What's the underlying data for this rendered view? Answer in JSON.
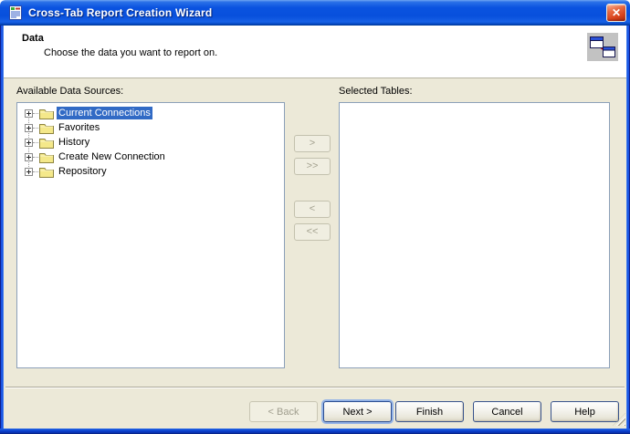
{
  "window": {
    "title": "Cross-Tab Report Creation Wizard",
    "close_icon": "✕"
  },
  "header": {
    "title": "Data",
    "subtitle": "Choose the data you want to report on."
  },
  "available": {
    "label": "Available Data Sources:"
  },
  "selected": {
    "label": "Selected Tables:"
  },
  "tree": {
    "items": [
      {
        "label": "Current Connections",
        "selected": true
      },
      {
        "label": "Favorites",
        "selected": false
      },
      {
        "label": "History",
        "selected": false
      },
      {
        "label": "Create New Connection",
        "selected": false
      },
      {
        "label": "Repository",
        "selected": false
      }
    ]
  },
  "transfer": {
    "add": ">",
    "add_all": ">>",
    "remove": "<",
    "remove_all": "<<"
  },
  "footer": {
    "back": "< Back",
    "next": "Next >",
    "finish": "Finish",
    "cancel": "Cancel",
    "help": "Help"
  },
  "colors": {
    "titlebar_blue": "#0850DC",
    "dialog_bg": "#ECE9D8",
    "selection_blue": "#316AC5",
    "control_border": "#8BA0B9",
    "close_red": "#D8431C"
  }
}
